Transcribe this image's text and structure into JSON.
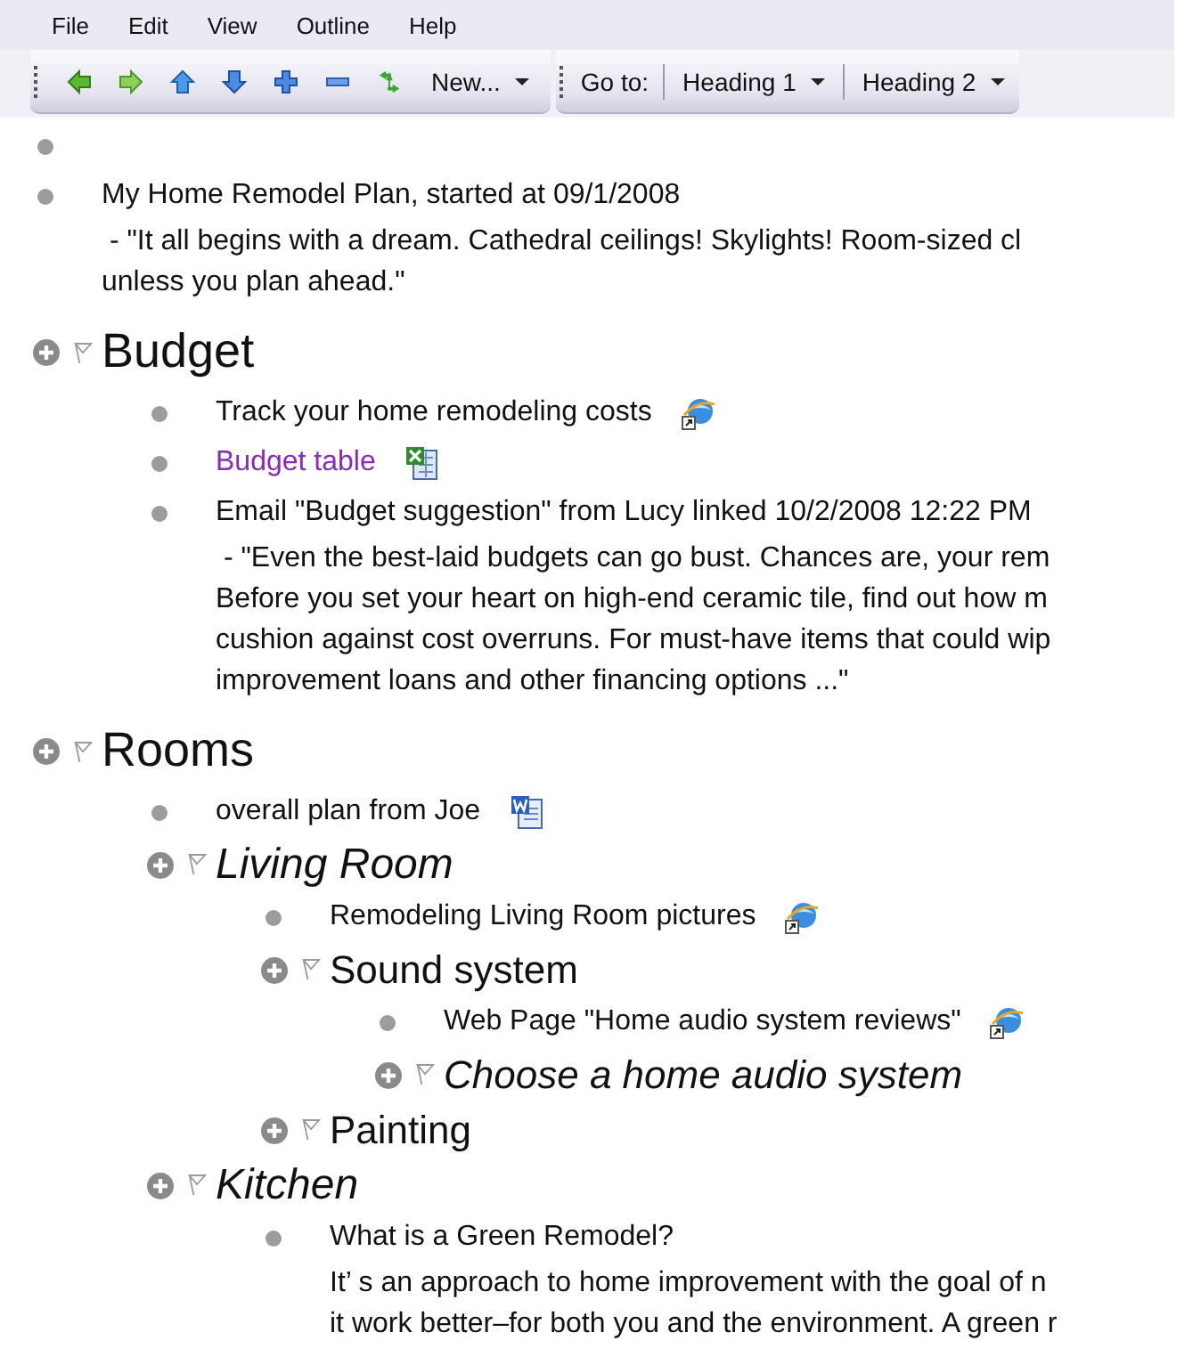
{
  "menu": [
    "File",
    "Edit",
    "View",
    "Outline",
    "Help"
  ],
  "toolbar": {
    "new_button": "New...",
    "goto_label": "Go to:",
    "dropdowns": [
      "Heading 1",
      "Heading 2"
    ]
  },
  "outline": [
    {
      "kind": "bullet"
    },
    {
      "kind": "bullet",
      "text": "My Home Remodel Plan, started at 09/1/2008",
      "link": false,
      "note": [
        " - \"It all begins with a dream. Cathedral ceilings! Skylights! Room-sized cl",
        "unless you plan ahead.\""
      ]
    },
    {
      "kind": "heading",
      "text": "Budget",
      "children": [
        {
          "kind": "bullet",
          "text": "Track your home remodeling costs",
          "link": false,
          "attachment": {
            "kind": "web"
          }
        },
        {
          "kind": "bullet",
          "text": "Budget table",
          "link": true,
          "attachment": {
            "kind": "spreadsheet"
          }
        },
        {
          "kind": "bullet",
          "text": "Email \"Budget suggestion\" from Lucy linked 10/2/2008 12:22 PM",
          "link": false,
          "note": [
            " - \"Even the best-laid budgets can go bust. Chances are, your rem",
            "Before you set your heart on high-end ceramic tile, find out how m",
            "cushion against cost overruns. For must-have items that could wip",
            "improvement loans and other financing options ...\""
          ]
        }
      ]
    },
    {
      "kind": "heading",
      "text": "Rooms",
      "children": [
        {
          "kind": "bullet",
          "text": "overall plan from Joe",
          "link": false,
          "attachment": {
            "kind": "document"
          }
        },
        {
          "kind": "heading",
          "text": "Living Room",
          "children": [
            {
              "kind": "bullet",
              "text": "Remodeling Living Room pictures",
              "link": false,
              "attachment": {
                "kind": "web"
              }
            },
            {
              "kind": "heading",
              "text": "Sound system",
              "children": [
                {
                  "kind": "bullet",
                  "text": "Web Page \"Home audio system reviews\"",
                  "link": false,
                  "attachment": {
                    "kind": "web"
                  }
                },
                {
                  "kind": "heading",
                  "text": "Choose a home audio system"
                }
              ]
            },
            {
              "kind": "heading",
              "text": "Painting"
            }
          ]
        },
        {
          "kind": "heading",
          "text": "Kitchen",
          "children": [
            {
              "kind": "bullet",
              "text": "What is a Green Remodel?",
              "link": false,
              "note": [
                "It’ s an approach to home improvement with the goal of n",
                "it work better–for both you and the environment. A green r"
              ]
            }
          ]
        }
      ]
    }
  ]
}
